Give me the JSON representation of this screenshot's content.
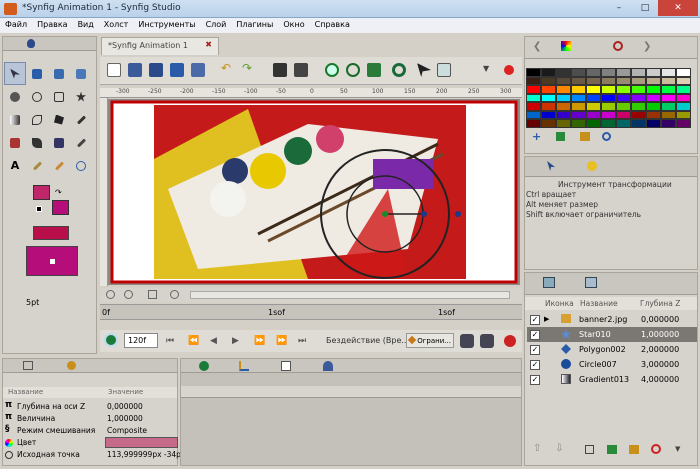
{
  "window": {
    "title": "*Synfig Animation 1 - Synfig Studio"
  },
  "menu": [
    "Файл",
    "Правка",
    "Вид",
    "Холст",
    "Инструменты",
    "Слой",
    "Плагины",
    "Окно",
    "Справка"
  ],
  "document": {
    "tab_label": "*Synfig Animation 1"
  },
  "ruler": {
    "ticks": [
      "-300",
      "-250",
      "-200",
      "-150",
      "-100",
      "-50",
      "0",
      "50",
      "100",
      "150",
      "200",
      "250",
      "300"
    ]
  },
  "timebar": {
    "marks": [
      "0f",
      "1sof",
      "1sof"
    ]
  },
  "transport": {
    "frame": "120f",
    "status": "Бездействие (Вре...",
    "limit_label": "Ограни..."
  },
  "toolbox": {
    "size_label": "5pt"
  },
  "tool_info": {
    "lines": [
      "Инструмент трансформации",
      "Ctrl вращает",
      "Alt меняет размер",
      "Shift включает ограничитель"
    ]
  },
  "palette": {
    "colors": [
      [
        "#000000",
        "#1a1a1a",
        "#333333",
        "#4d4d4d",
        "#666666",
        "#808080",
        "#999999",
        "#b3b3b3",
        "#cccccc",
        "#e6e6e6",
        "#ffffff"
      ],
      [
        "#3a1f14",
        "#4a3a24",
        "#5a4a3a",
        "#6a5a42",
        "#7a6650",
        "#8a7a5e",
        "#9a8a6e",
        "#aa9a7e",
        "#bcab8e",
        "#ccbc9e",
        "#ddd0b4"
      ],
      [
        "#ff0000",
        "#ff4400",
        "#ff8800",
        "#ffcc00",
        "#ffff00",
        "#ccff00",
        "#88ff00",
        "#44ff00",
        "#00ff00",
        "#00ff44",
        "#00ff88"
      ],
      [
        "#00ffcc",
        "#00ffff",
        "#00ccff",
        "#0088ff",
        "#0044ff",
        "#0000ff",
        "#4400ff",
        "#8800ff",
        "#cc00ff",
        "#ff00ff",
        "#ff00cc"
      ],
      [
        "#cc0000",
        "#cc3300",
        "#cc6600",
        "#cc9900",
        "#cccc00",
        "#99cc00",
        "#66cc00",
        "#33cc00",
        "#00cc00",
        "#00cc66",
        "#00cccc"
      ],
      [
        "#0066cc",
        "#0000cc",
        "#3300cc",
        "#6600cc",
        "#9900cc",
        "#cc00cc",
        "#cc0066",
        "#990000",
        "#993300",
        "#996600",
        "#999900"
      ],
      [
        "#660000",
        "#663300",
        "#666600",
        "#336600",
        "#006600",
        "#006633",
        "#006666",
        "#003366",
        "#000066",
        "#330066",
        "#660066"
      ]
    ]
  },
  "layers": {
    "headers": {
      "icon": "Иконка",
      "name": "Название",
      "depth": "Глубина Z"
    },
    "rows": [
      {
        "name": "banner2.jpg",
        "depth": "0,000000",
        "selected": false
      },
      {
        "name": "Star010",
        "depth": "1,000000",
        "selected": true
      },
      {
        "name": "Polygon002",
        "depth": "2,000000",
        "selected": false
      },
      {
        "name": "Circle007",
        "depth": "3,000000",
        "selected": false
      },
      {
        "name": "Gradient013",
        "depth": "4,000000",
        "selected": false
      }
    ]
  },
  "params": {
    "headers": {
      "name": "Название",
      "value": "Значение"
    },
    "rows": [
      {
        "name": "Глубина на оси Z",
        "value": "0,000000"
      },
      {
        "name": "Величина",
        "value": "1,000000"
      },
      {
        "name": "Режим смешивания",
        "value": "Composite"
      },
      {
        "name": "Цвет",
        "value": ""
      },
      {
        "name": "Исходная точка",
        "value": "113,999999px -34px"
      }
    ]
  },
  "colors": {
    "outline": "#c0266a",
    "fill": "#b50e7a",
    "canvas_border": "#c00000"
  }
}
